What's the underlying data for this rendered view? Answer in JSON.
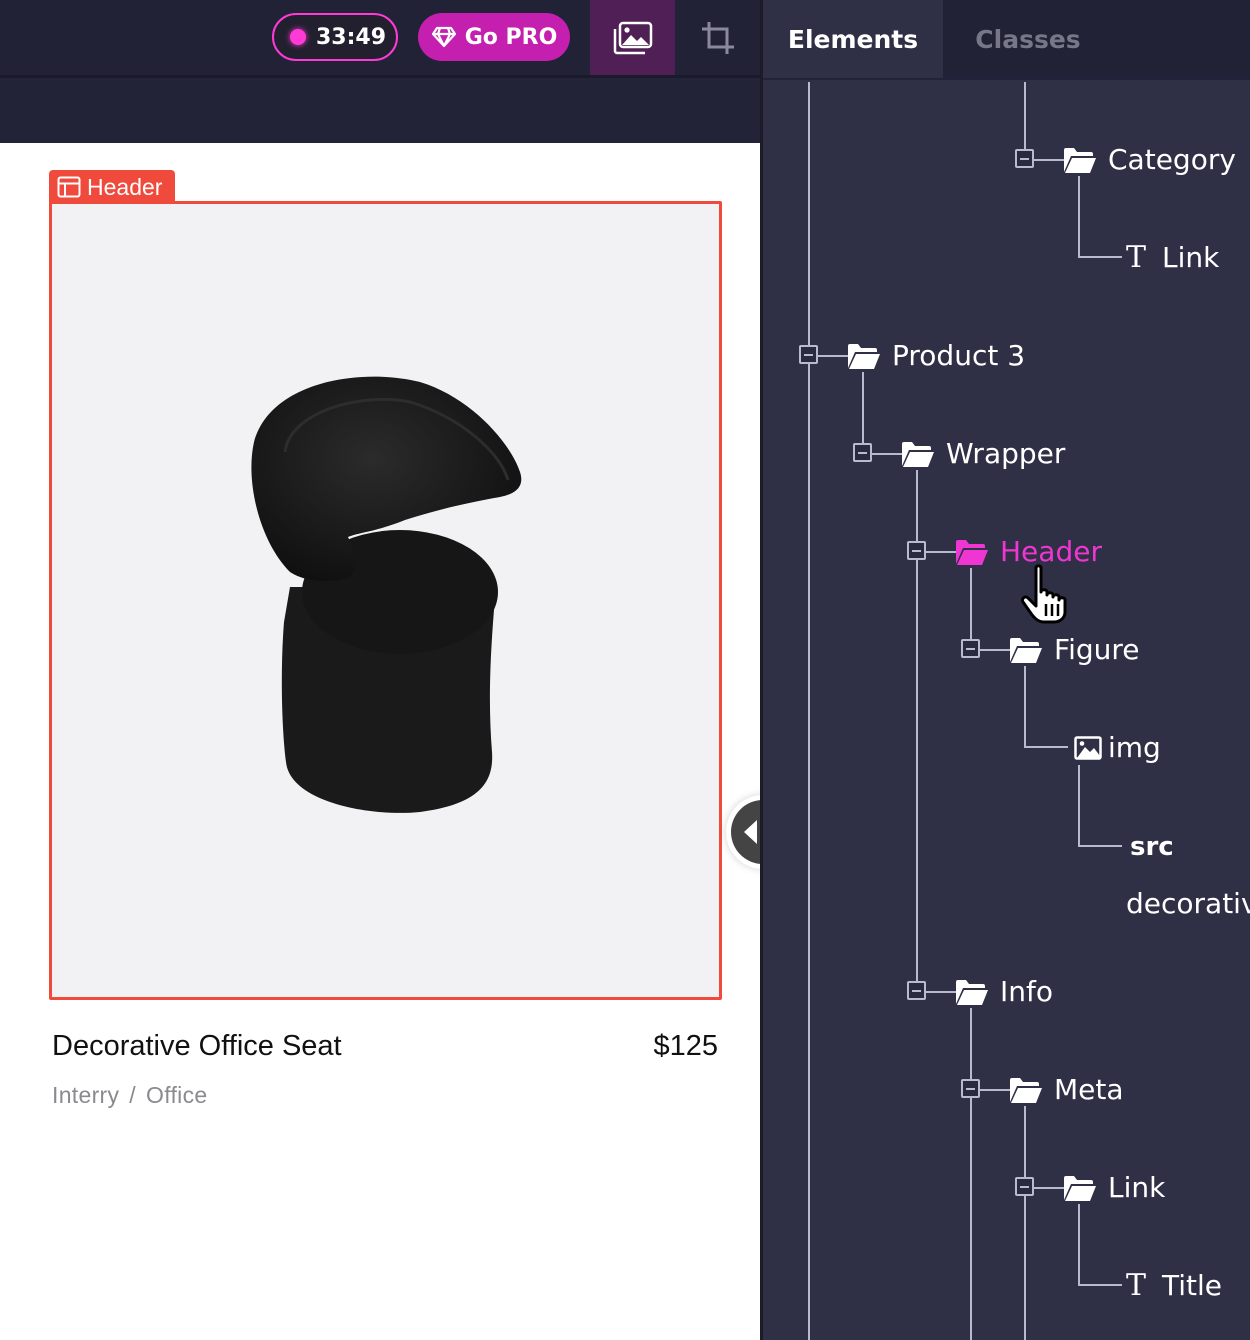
{
  "toolbar": {
    "timer": "33:49",
    "go_pro_label": "Go PRO",
    "icons": [
      "record-dot-icon",
      "diamond-icon",
      "image-gallery-icon",
      "crop-icon"
    ],
    "colors": {
      "accent": "#ff3ad6",
      "pro_button": "#c51fb0",
      "active_tool": "#4f1f55"
    }
  },
  "canvas": {
    "selection_tag": "Header",
    "selection_color": "#f04a3c",
    "product": {
      "title": "Decorative Office Seat",
      "price": "$125",
      "brand": "Interry",
      "separator": "/",
      "category": "Office"
    }
  },
  "panel": {
    "tabs": [
      {
        "label": "Elements",
        "active": true
      },
      {
        "label": "Classes",
        "active": false
      }
    ],
    "tree": [
      {
        "label": "Category",
        "type": "folder",
        "expanded": true
      },
      {
        "label": "Link",
        "type": "text"
      },
      {
        "label": "Product 3",
        "type": "folder",
        "expanded": true
      },
      {
        "label": "Wrapper",
        "type": "folder",
        "expanded": true
      },
      {
        "label": "Header",
        "type": "folder",
        "expanded": true,
        "selected": true
      },
      {
        "label": "Figure",
        "type": "folder",
        "expanded": true
      },
      {
        "label": "img",
        "type": "image"
      },
      {
        "label": "src",
        "type": "attribute"
      },
      {
        "label": "decorativ",
        "type": "attribute-value"
      },
      {
        "label": "Info",
        "type": "folder",
        "expanded": true
      },
      {
        "label": "Meta",
        "type": "folder",
        "expanded": true
      },
      {
        "label": "Link",
        "type": "folder",
        "expanded": true
      },
      {
        "label": "Title",
        "type": "text"
      }
    ],
    "selected_color": "#ef36d3"
  }
}
